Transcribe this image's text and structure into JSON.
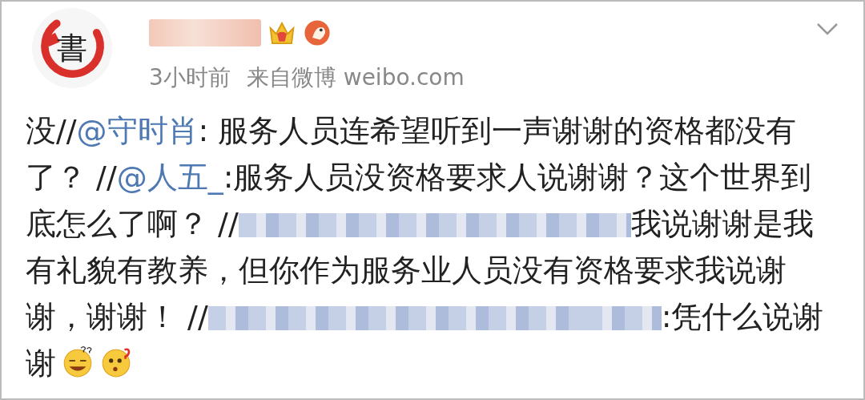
{
  "post": {
    "avatar_text": "書",
    "time": "3小时前",
    "source": "来自微博 weibo.com",
    "body": [
      {
        "kind": "text",
        "text": "没//"
      },
      {
        "kind": "mention",
        "text": "@守时肖"
      },
      {
        "kind": "text",
        "text": ": 服务人员连希望听到一声谢谢的资格都没有了？ //"
      },
      {
        "kind": "mention",
        "text": "@人五_"
      },
      {
        "kind": "text",
        "text": ":服务人员没资格要求人说谢谢？这个世界到底怎么了啊？ //"
      },
      {
        "kind": "blurred"
      },
      {
        "kind": "text",
        "text": "我说谢谢是我有礼貌有教养，但你作为服务业人员没有资格要求我说谢谢，谢谢！ //"
      },
      {
        "kind": "blurred"
      },
      {
        "kind": "blurred"
      },
      {
        "kind": "text",
        "text": ":凭什么说谢谢"
      },
      {
        "kind": "emoji"
      },
      {
        "kind": "emoji"
      }
    ]
  }
}
